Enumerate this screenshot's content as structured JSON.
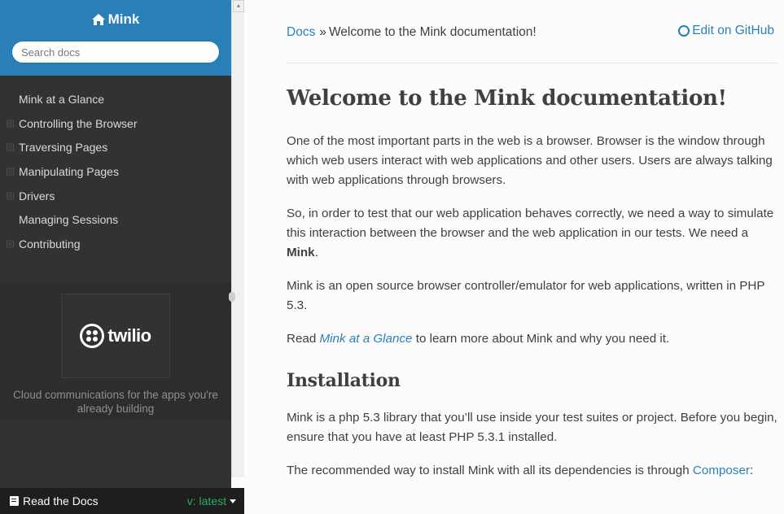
{
  "sidebar": {
    "brand": "Mink",
    "search_placeholder": "Search docs",
    "items": [
      {
        "label": "Mink at a Glance",
        "expandable": false
      },
      {
        "label": "Controlling the Browser",
        "expandable": true
      },
      {
        "label": "Traversing Pages",
        "expandable": true
      },
      {
        "label": "Manipulating Pages",
        "expandable": true
      },
      {
        "label": "Drivers",
        "expandable": true
      },
      {
        "label": "Managing Sessions",
        "expandable": false
      },
      {
        "label": "Contributing",
        "expandable": true
      }
    ],
    "toggle_symbol": "⊞",
    "ad": {
      "logo_text": "twilio",
      "line1": "Cloud communications for the apps you're",
      "line2": "already building"
    }
  },
  "footer": {
    "rtd_label": "Read the Docs",
    "version": "v: latest"
  },
  "breadcrumbs": {
    "docs": "Docs",
    "separator": "»",
    "current": "Welcome to the Mink documentation!",
    "edit_github": "Edit on GitHub"
  },
  "main": {
    "title": "Welcome to the Mink documentation!",
    "p1": "One of the most important parts in the web is a browser. Browser is the window through which web users interact with web applications and other users. Users are always talking with web applications through browsers.",
    "p2_before": "So, in order to test that our web application behaves correctly, we need a way to simulate this interaction between the browser and the web application in our tests. We need a ",
    "p2_strong": "Mink",
    "p2_after": ".",
    "p3": "Mink is an open source browser controller/emulator for web applications, written in PHP 5.3.",
    "p4_before": "Read ",
    "p4_link": "Mink at a Glance",
    "p4_after": " to learn more about Mink and why you need it.",
    "h2_installation": "Installation",
    "p5": "Mink is a php 5.3 library that you’ll use inside your test suites or project. Before you begin, ensure that you have at least PHP 5.3.1 installed.",
    "p6_before": "The recommended way to install Mink with all its dependencies is through ",
    "p6_link": "Composer",
    "p6_after": ":"
  },
  "colors": {
    "sidebar_bg": "#343131",
    "header_blue": "#2980b9",
    "link": "#2980b9",
    "version_green": "#27ae60"
  }
}
